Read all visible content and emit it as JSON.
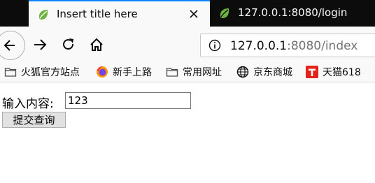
{
  "tabs": [
    {
      "title": "Insert title here",
      "active": true,
      "icon": "spring-leaf-icon"
    },
    {
      "title": "127.0.0.1:8080/login",
      "active": false,
      "icon": "spring-leaf-icon"
    }
  ],
  "nav": {
    "back_icon": "back-arrow-icon",
    "forward_icon": "forward-arrow-icon",
    "reload_icon": "reload-icon",
    "home_icon": "home-icon",
    "url_host": "127.0.0.1",
    "url_rest": ":8080/index",
    "info_icon": "info-icon"
  },
  "bookmarks": [
    {
      "label": "火狐官方站点",
      "icon": "folder-icon"
    },
    {
      "label": "新手上路",
      "icon": "firefox-icon"
    },
    {
      "label": "常用网址",
      "icon": "folder-icon"
    },
    {
      "label": "京东商城",
      "icon": "globe-icon"
    },
    {
      "label": "天猫618",
      "icon": "tmall-icon"
    }
  ],
  "form": {
    "label": "输入内容:",
    "input_value": "123",
    "submit_label": "提交查询"
  },
  "colors": {
    "tabbar_bg": "#0c0c0d",
    "active_tab_bg": "#f9f9fa",
    "accent": "#0a84ff",
    "spring_green": "#6db33f"
  }
}
